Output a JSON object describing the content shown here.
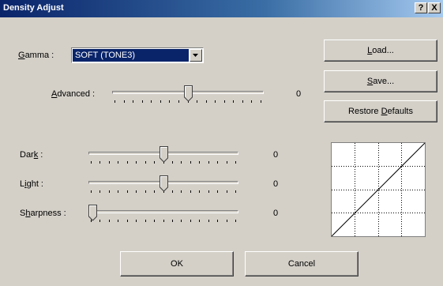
{
  "window": {
    "title": "Density Adjust",
    "help_label": "?",
    "close_label": "X"
  },
  "gamma": {
    "label": "Gamma :",
    "selected": "SOFT (TONE3)"
  },
  "advanced": {
    "label": "Advanced :",
    "value": "0"
  },
  "dark": {
    "label": "Dark :",
    "value": "0"
  },
  "light": {
    "label": "Light :",
    "value": "0"
  },
  "sharpness": {
    "label": "Sharpness :",
    "value": "0"
  },
  "buttons": {
    "load": "Load...",
    "save": "Save...",
    "restore": "Restore Defaults",
    "ok": "OK",
    "cancel": "Cancel"
  },
  "colors": {
    "titlebar_start": "#0a246a",
    "titlebar_end": "#a6caf0",
    "face": "#d4d0c8",
    "selection": "#0a246a"
  },
  "icons": {
    "help": "question-mark-icon",
    "close": "close-icon",
    "dropdown": "chevron-down-icon"
  }
}
